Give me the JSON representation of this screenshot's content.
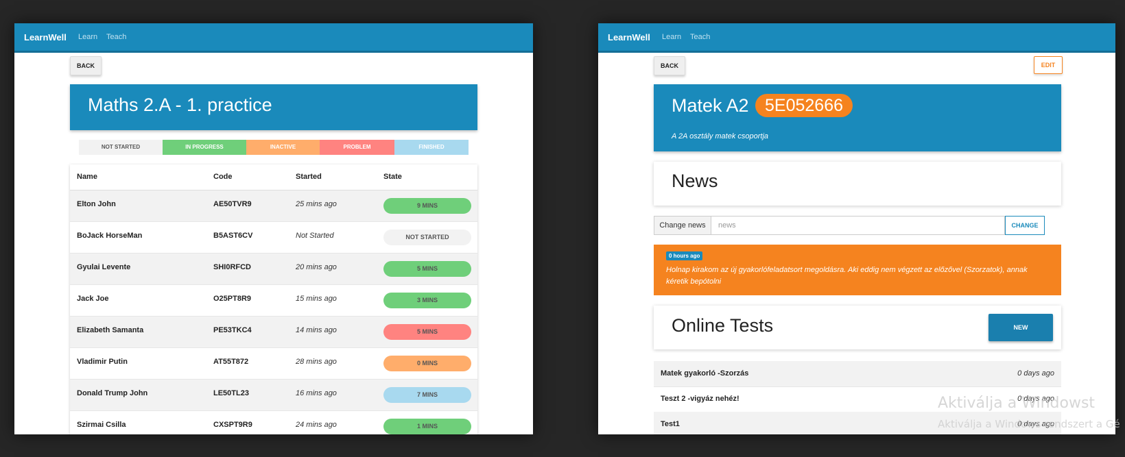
{
  "left": {
    "brand": "LearnWell",
    "nav": [
      "Learn",
      "Teach"
    ],
    "back_label": "BACK",
    "title": "Maths 2.A - 1. practice",
    "legend": [
      {
        "label": "NOT STARTED",
        "color": "#f2f2f2"
      },
      {
        "label": "IN PROGRESS",
        "color": "#6fcf7a"
      },
      {
        "label": "INACTIVE",
        "color": "#ffad6b"
      },
      {
        "label": "PROBLEM",
        "color": "#ff8380"
      },
      {
        "label": "FINISHED",
        "color": "#a8d9ef"
      }
    ],
    "headers": [
      "Name",
      "Code",
      "Started",
      "State"
    ],
    "rows": [
      {
        "name": "Elton John",
        "code": "AE50TVR9",
        "started": "25 mins ago",
        "state": "9 MINS",
        "color": "#6fcf7a"
      },
      {
        "name": "BoJack HorseMan",
        "code": "B5AST6CV",
        "started": "Not Started",
        "state": "NOT STARTED",
        "color": "#f2f2f2"
      },
      {
        "name": "Gyulai Levente",
        "code": "SHI0RFCD",
        "started": "20 mins ago",
        "state": "5 MINS",
        "color": "#6fcf7a"
      },
      {
        "name": "Jack Joe",
        "code": "O25PT8R9",
        "started": "15 mins ago",
        "state": "3 MINS",
        "color": "#6fcf7a"
      },
      {
        "name": "Elizabeth Samanta",
        "code": "PE53TKC4",
        "started": "14 mins ago",
        "state": "5 MINS",
        "color": "#ff8380"
      },
      {
        "name": "Vladimir Putin",
        "code": "AT55T872",
        "started": "28 mins ago",
        "state": "0 MINS",
        "color": "#ffad6b"
      },
      {
        "name": "Donald Trump John",
        "code": "LE50TL23",
        "started": "16 mins ago",
        "state": "7 MINS",
        "color": "#a8d9ef"
      },
      {
        "name": "Szirmai Csilla",
        "code": "CXSPT9R9",
        "started": "24 mins ago",
        "state": "1 MINS",
        "color": "#6fcf7a"
      }
    ]
  },
  "right": {
    "brand": "LearnWell",
    "nav": [
      "Learn",
      "Teach"
    ],
    "back_label": "BACK",
    "edit_label": "EDIT",
    "group_name": "Matek A2",
    "group_code": "5E052666",
    "group_description": "A 2A osztály matek csoportja",
    "news_title": "News",
    "change_news_label": "Change news",
    "news_placeholder": "news",
    "change_button": "CHANGE",
    "news_item": {
      "time": "0 hours ago",
      "text": "Holnap kirakom az új gyakorlófeladatsort megoldásra. Aki eddig nem végzett az előzővel (Szorzatok), annak kéretik bepótolni"
    },
    "tests_title": "Online Tests",
    "new_button": "NEW",
    "tests": [
      {
        "name": "Matek gyakorló -Szorzás",
        "time": "0 days ago"
      },
      {
        "name": "Teszt 2 -vigyáz nehéz!",
        "time": "0 days ago"
      },
      {
        "name": "Test1",
        "time": "0 days ago"
      }
    ]
  },
  "watermark": {
    "line1": "Aktiválja a Windowst",
    "line2": "Aktiválja a Windows rendszert a Gé"
  },
  "colors": {
    "primary": "#1a8abb",
    "accent": "#f5831f"
  }
}
